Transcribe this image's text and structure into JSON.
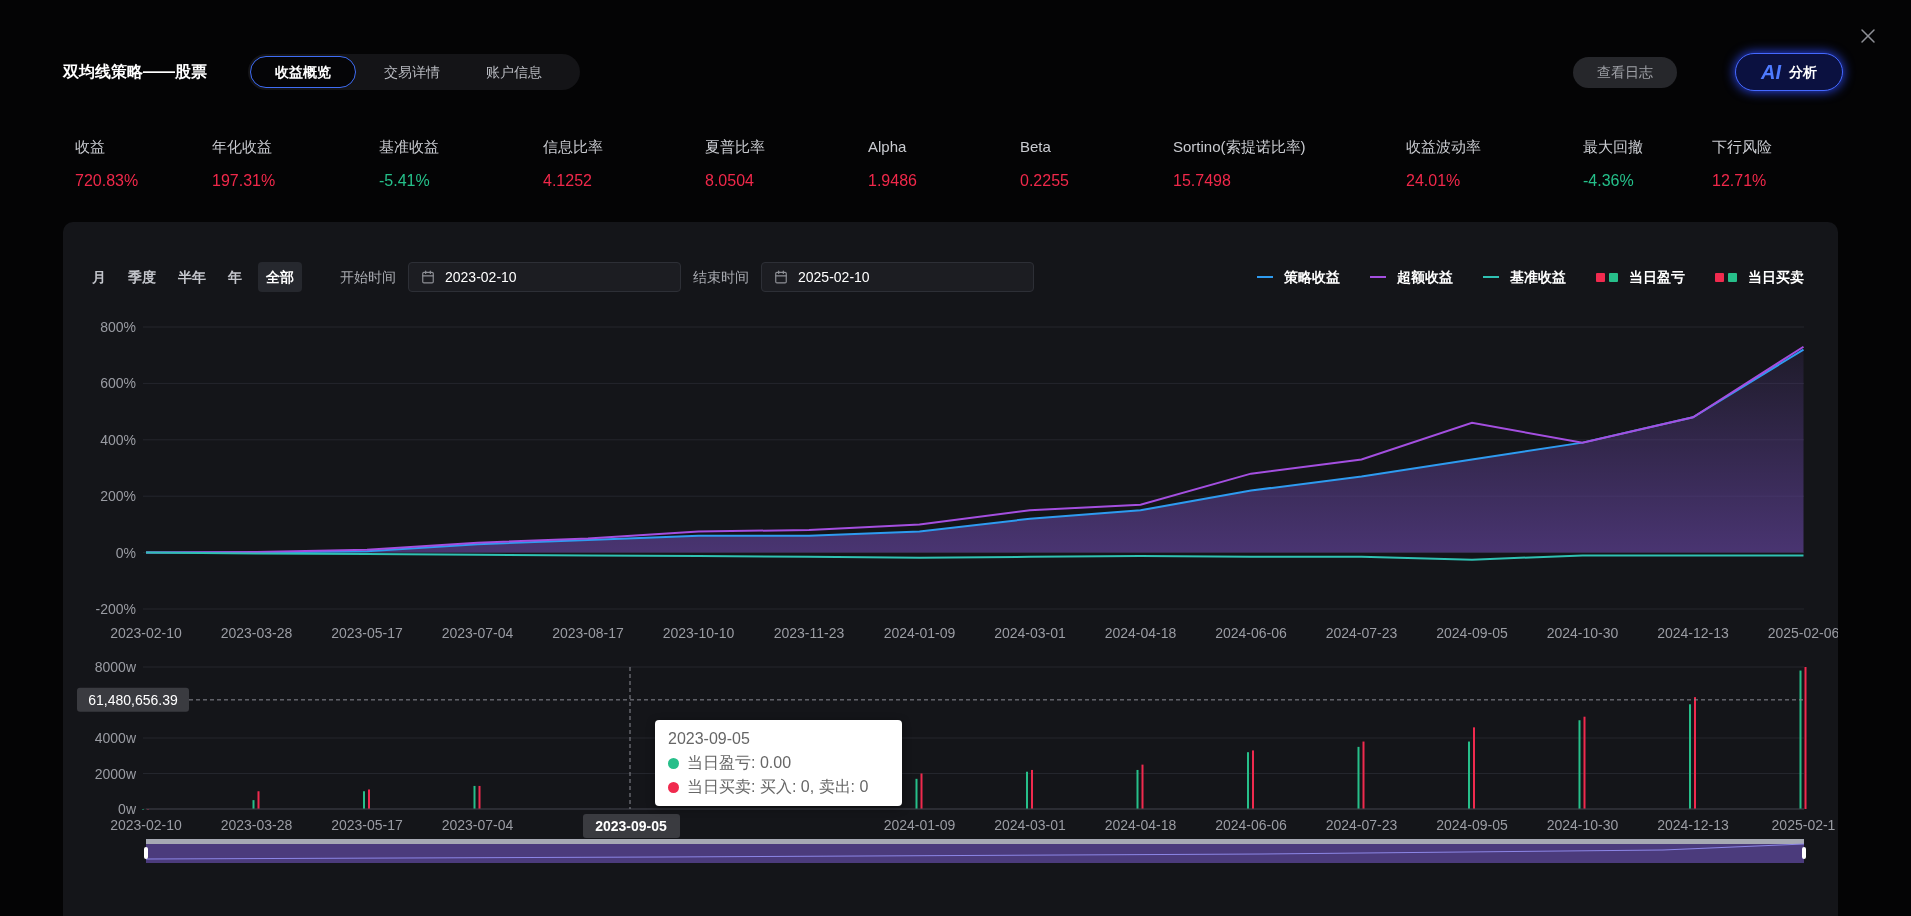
{
  "header": {
    "title": "双均线策略——股票",
    "tabs": [
      {
        "label": "收益概览",
        "selected": true
      },
      {
        "label": "交易详情",
        "selected": false
      },
      {
        "label": "账户信息",
        "selected": false
      }
    ],
    "log_button": "查看日志",
    "ai_button": {
      "badge": "AI",
      "label": "分析"
    }
  },
  "metrics": [
    {
      "label": "收益",
      "value": "720.83%",
      "color": "#f0284a"
    },
    {
      "label": "年化收益",
      "value": "197.31%",
      "color": "#f0284a"
    },
    {
      "label": "基准收益",
      "value": "-5.41%",
      "color": "#25c08a"
    },
    {
      "label": "信息比率",
      "value": "4.1252",
      "color": "#f0284a"
    },
    {
      "label": "夏普比率",
      "value": "8.0504",
      "color": "#f0284a"
    },
    {
      "label": "Alpha",
      "value": "1.9486",
      "color": "#f0284a"
    },
    {
      "label": "Beta",
      "value": "0.2255",
      "color": "#f0284a"
    },
    {
      "label": "Sortino(索提诺比率)",
      "value": "15.7498",
      "color": "#f0284a"
    },
    {
      "label": "收益波动率",
      "value": "24.01%",
      "color": "#f0284a"
    },
    {
      "label": "最大回撤",
      "value": "-4.36%",
      "color": "#25c08a"
    },
    {
      "label": "下行风险",
      "value": "12.71%",
      "color": "#f0284a"
    }
  ],
  "periods": [
    {
      "label": "月",
      "selected": false
    },
    {
      "label": "季度",
      "selected": false
    },
    {
      "label": "半年",
      "selected": false
    },
    {
      "label": "年",
      "selected": false
    },
    {
      "label": "全部",
      "selected": true
    }
  ],
  "date_range": [
    {
      "label": "开始时间",
      "value": "2023-02-10"
    },
    {
      "label": "结束时间",
      "value": "2025-02-10"
    }
  ],
  "legend_swatches": [
    {
      "kind": "line"
    },
    {
      "kind": "line"
    },
    {
      "kind": "line"
    },
    {
      "kind": "pair",
      "squares": [
        {
          "color": "#f02a4e"
        },
        {
          "color": "#27bf8a"
        }
      ]
    },
    {
      "kind": "pair",
      "squares": [
        {
          "color": "#f02a4e"
        },
        {
          "color": "#27bf8a"
        }
      ]
    }
  ],
  "return_chart": {
    "chart_data": {
      "type": "line",
      "ylim": [
        -200,
        800
      ],
      "grid": true,
      "x": [
        "2023-02-10",
        "2023-03-28",
        "2023-05-17",
        "2023-07-04",
        "2023-08-17",
        "2023-10-10",
        "2023-11-23",
        "2024-01-09",
        "2024-03-01",
        "2024-04-18",
        "2024-06-06",
        "2024-07-23",
        "2024-09-05",
        "2024-10-30",
        "2024-12-13",
        "2025-02-06"
      ],
      "yticks": [
        {
          "value": -200,
          "label": "-200%"
        },
        {
          "value": 0,
          "label": "0%"
        },
        {
          "value": 200,
          "label": "200%"
        },
        {
          "value": 400,
          "label": "400%"
        },
        {
          "value": 600,
          "label": "600%"
        },
        {
          "value": 800,
          "label": "800%"
        }
      ],
      "series": [
        {
          "name": "策略收益",
          "type": "area",
          "color": "#2e9bf0",
          "values": [
            0,
            0,
            5,
            30,
            45,
            60,
            60,
            75,
            120,
            150,
            220,
            270,
            330,
            390,
            480,
            720
          ]
        },
        {
          "name": "超额收益",
          "type": "line",
          "color": "#a44fe0",
          "values": [
            0,
            2,
            10,
            35,
            50,
            75,
            80,
            100,
            150,
            170,
            280,
            330,
            460,
            390,
            480,
            730
          ]
        },
        {
          "name": "基准收益",
          "type": "line",
          "color": "#2fc1b3",
          "values": [
            0,
            -3,
            -5,
            -8,
            -10,
            -12,
            -15,
            -18,
            -15,
            -12,
            -15,
            -15,
            -25,
            -10,
            -10,
            -10
          ]
        }
      ]
    }
  },
  "pnl_chart": {
    "chart_data": {
      "type": "bar",
      "ylim": [
        0,
        8000
      ],
      "grid": true,
      "ref_lines": [
        {
          "axis": "y",
          "value": 6148.065639
        }
      ],
      "categories": [
        "2023-02-10",
        "2023-03-28",
        "2023-05-17",
        "2023-07-04",
        "2024-01-09",
        "2024-03-01",
        "2024-04-18",
        "2024-06-06",
        "2024-07-23",
        "2024-09-05",
        "2024-10-30",
        "2024-12-13",
        "2025-02-1"
      ],
      "yticks": [
        {
          "value": 0,
          "label": "0w"
        },
        {
          "value": 2000,
          "label": "2000w"
        },
        {
          "value": 4000,
          "label": "4000w"
        },
        {
          "value": 8000,
          "label": "8000w"
        }
      ],
      "series": [
        {
          "name": "当日盈亏",
          "color": "#27bf8a",
          "values": [
            0,
            500,
            1000,
            1300,
            1700,
            2100,
            2200,
            3200,
            3500,
            3800,
            5000,
            5900,
            7800
          ]
        },
        {
          "name": "当日买卖",
          "color": "#f02a4e",
          "values": [
            0,
            1000,
            1100,
            1300,
            2000,
            2200,
            2500,
            3300,
            3800,
            4600,
            5200,
            6300,
            8000
          ]
        }
      ]
    },
    "axis_pointer": {
      "y_label": "61,480,656.39",
      "x_label": "2023-09-05"
    },
    "tooltip": {
      "title": "2023-09-05",
      "rows": [
        {
          "text": "当日盈亏: 0.00",
          "color": "#27bf8a"
        },
        {
          "text": "当日买卖: 买入: 0, 卖出: 0",
          "color": "#f02a4e"
        }
      ]
    }
  }
}
